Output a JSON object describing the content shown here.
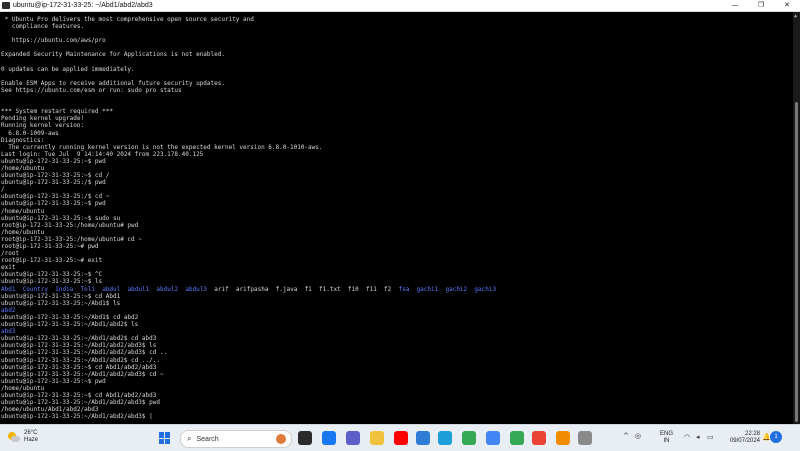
{
  "window": {
    "title": "ubuntu@ip-172-31-33-25: ~/Abd1/abd2/abd3",
    "minimize": "—",
    "maximize": "❐",
    "close": "✕"
  },
  "terminal": {
    "lines": [
      [
        {
          "t": " * Ubuntu Pro delivers the most comprehensive open source security and"
        }
      ],
      [
        {
          "t": "   compliance features."
        }
      ],
      [
        {
          "t": ""
        }
      ],
      [
        {
          "t": "   https://ubuntu.com/aws/pro"
        }
      ],
      [
        {
          "t": ""
        }
      ],
      [
        {
          "t": "Expanded Security Maintenance for Applications is not enabled."
        }
      ],
      [
        {
          "t": ""
        }
      ],
      [
        {
          "t": "0 updates can be applied immediately."
        }
      ],
      [
        {
          "t": ""
        }
      ],
      [
        {
          "t": "Enable ESM Apps to receive additional future security updates."
        }
      ],
      [
        {
          "t": "See https://ubuntu.com/esm or run: sudo pro status"
        }
      ],
      [
        {
          "t": ""
        }
      ],
      [
        {
          "t": ""
        }
      ],
      [
        {
          "t": "*** System restart required ***"
        }
      ],
      [
        {
          "t": "Pending kernel upgrade!"
        }
      ],
      [
        {
          "t": "Running kernel version:"
        }
      ],
      [
        {
          "t": "  6.8.0-1009-aws"
        }
      ],
      [
        {
          "t": "Diagnostics:"
        }
      ],
      [
        {
          "t": "  The currently running kernel version is not the expected kernel version 6.8.0-1010-aws."
        }
      ],
      [
        {
          "t": "Last login: Tue Jul  9 14:14:40 2024 from 223.178.40.125"
        }
      ],
      [
        {
          "t": "ubuntu@ip-172-31-33-25:~$ pwd"
        }
      ],
      [
        {
          "t": "/home/ubuntu"
        }
      ],
      [
        {
          "t": "ubuntu@ip-172-31-33-25:~$ cd /"
        }
      ],
      [
        {
          "t": "ubuntu@ip-172-31-33-25:/$ pwd"
        }
      ],
      [
        {
          "t": "/"
        }
      ],
      [
        {
          "t": "ubuntu@ip-172-31-33-25:/$ cd ~"
        }
      ],
      [
        {
          "t": "ubuntu@ip-172-31-33-25:~$ pwd"
        }
      ],
      [
        {
          "t": "/home/ubuntu"
        }
      ],
      [
        {
          "t": "ubuntu@ip-172-31-33-25:~$ sudo su"
        }
      ],
      [
        {
          "t": "root@ip-172-31-33-25:/home/ubuntu# pwd"
        }
      ],
      [
        {
          "t": "/home/ubuntu"
        }
      ],
      [
        {
          "t": "root@ip-172-31-33-25:/home/ubuntu# cd ~"
        }
      ],
      [
        {
          "t": "root@ip-172-31-33-25:~# pwd"
        }
      ],
      [
        {
          "t": "/root"
        }
      ],
      [
        {
          "t": "root@ip-172-31-33-25:~# exit"
        }
      ],
      [
        {
          "t": "exit"
        }
      ],
      [
        {
          "t": "ubuntu@ip-172-31-33-25:~$ ^C"
        }
      ],
      [
        {
          "t": "ubuntu@ip-172-31-33-25:~$ ls"
        }
      ],
      [
        {
          "t": "Abd1",
          "c": "blue"
        },
        {
          "t": "  "
        },
        {
          "t": "Country",
          "c": "blue"
        },
        {
          "t": "  "
        },
        {
          "t": "India",
          "c": "blue"
        },
        {
          "t": "  "
        },
        {
          "t": "Toli",
          "c": "blue"
        },
        {
          "t": "  "
        },
        {
          "t": "abdul",
          "c": "blue"
        },
        {
          "t": "  "
        },
        {
          "t": "abdul1",
          "c": "blue"
        },
        {
          "t": "  "
        },
        {
          "t": "abdul2",
          "c": "blue"
        },
        {
          "t": "  "
        },
        {
          "t": "abdul3",
          "c": "blue"
        },
        {
          "t": "  arif  arifpasha  f.java  f1  f1.txt  f10  f11  f2  "
        },
        {
          "t": "fsa",
          "c": "blue"
        },
        {
          "t": "  "
        },
        {
          "t": "gachi1",
          "c": "blue"
        },
        {
          "t": "  "
        },
        {
          "t": "gachi2",
          "c": "blue"
        },
        {
          "t": "  "
        },
        {
          "t": "gachi3",
          "c": "blue"
        }
      ],
      [
        {
          "t": "ubuntu@ip-172-31-33-25:~$ cd Abd1"
        }
      ],
      [
        {
          "t": "ubuntu@ip-172-31-33-25:~/Abd1$ ls"
        }
      ],
      [
        {
          "t": "abd2",
          "c": "blue"
        }
      ],
      [
        {
          "t": "ubuntu@ip-172-31-33-25:~/Abd1$ cd abd2"
        }
      ],
      [
        {
          "t": "ubuntu@ip-172-31-33-25:~/Abd1/abd2$ ls"
        }
      ],
      [
        {
          "t": "abd3",
          "c": "blue"
        }
      ],
      [
        {
          "t": "ubuntu@ip-172-31-33-25:~/Abd1/abd2$ cd abd3"
        }
      ],
      [
        {
          "t": "ubuntu@ip-172-31-33-25:~/Abd1/abd2/abd3$ ls"
        }
      ],
      [
        {
          "t": "ubuntu@ip-172-31-33-25:~/Abd1/abd2/abd3$ cd .."
        }
      ],
      [
        {
          "t": "ubuntu@ip-172-31-33-25:~/Abd1/abd2$ cd ../.."
        }
      ],
      [
        {
          "t": "ubuntu@ip-172-31-33-25:~$ cd Abd1/abd2/abd3"
        }
      ],
      [
        {
          "t": "ubuntu@ip-172-31-33-25:~/Abd1/abd2/abd3$ cd ~"
        }
      ],
      [
        {
          "t": "ubuntu@ip-172-31-33-25:~$ pwd"
        }
      ],
      [
        {
          "t": "/home/ubuntu"
        }
      ],
      [
        {
          "t": "ubuntu@ip-172-31-33-25:~$ cd Abd1/abd2/abd3"
        }
      ],
      [
        {
          "t": "ubuntu@ip-172-31-33-25:~/Abd1/abd2/abd3$ pwd"
        }
      ],
      [
        {
          "t": "/home/ubuntu/Abd1/abd2/abd3"
        }
      ],
      [
        {
          "t": "ubuntu@ip-172-31-33-25:~/Abd1/abd2/abd3$ |"
        }
      ]
    ]
  },
  "taskbar": {
    "weather_temp": "26°C",
    "weather_desc": "Haze",
    "search_label": "Search",
    "search_icon": "⌕",
    "tray_chevron": "^",
    "language_top": "ENG",
    "language_bottom": "IN",
    "time": "22:28",
    "date": "09/07/2024",
    "notification_count": "1",
    "apps": [
      {
        "name": "file-explorer-dark-icon",
        "color": "#2b2b2b"
      },
      {
        "name": "facebook-icon",
        "color": "#1877f2"
      },
      {
        "name": "teams-icon",
        "color": "#5b5fc7"
      },
      {
        "name": "folder-icon",
        "color": "#f2c23e"
      },
      {
        "name": "youtube-icon",
        "color": "#ff0000"
      },
      {
        "name": "app-blue-icon",
        "color": "#2f7cd6"
      },
      {
        "name": "edge-icon",
        "color": "#1c9fd9"
      },
      {
        "name": "chrome-icon",
        "color": "#34a853"
      },
      {
        "name": "chrome-profile-2-icon",
        "color": "#4285f4"
      },
      {
        "name": "chrome-profile-3-icon",
        "color": "#34a853"
      },
      {
        "name": "chrome-profile-4-icon",
        "color": "#ea4335"
      },
      {
        "name": "vlc-icon",
        "color": "#f28c00"
      },
      {
        "name": "terminal-app-icon",
        "color": "#8a8a8a"
      }
    ]
  }
}
